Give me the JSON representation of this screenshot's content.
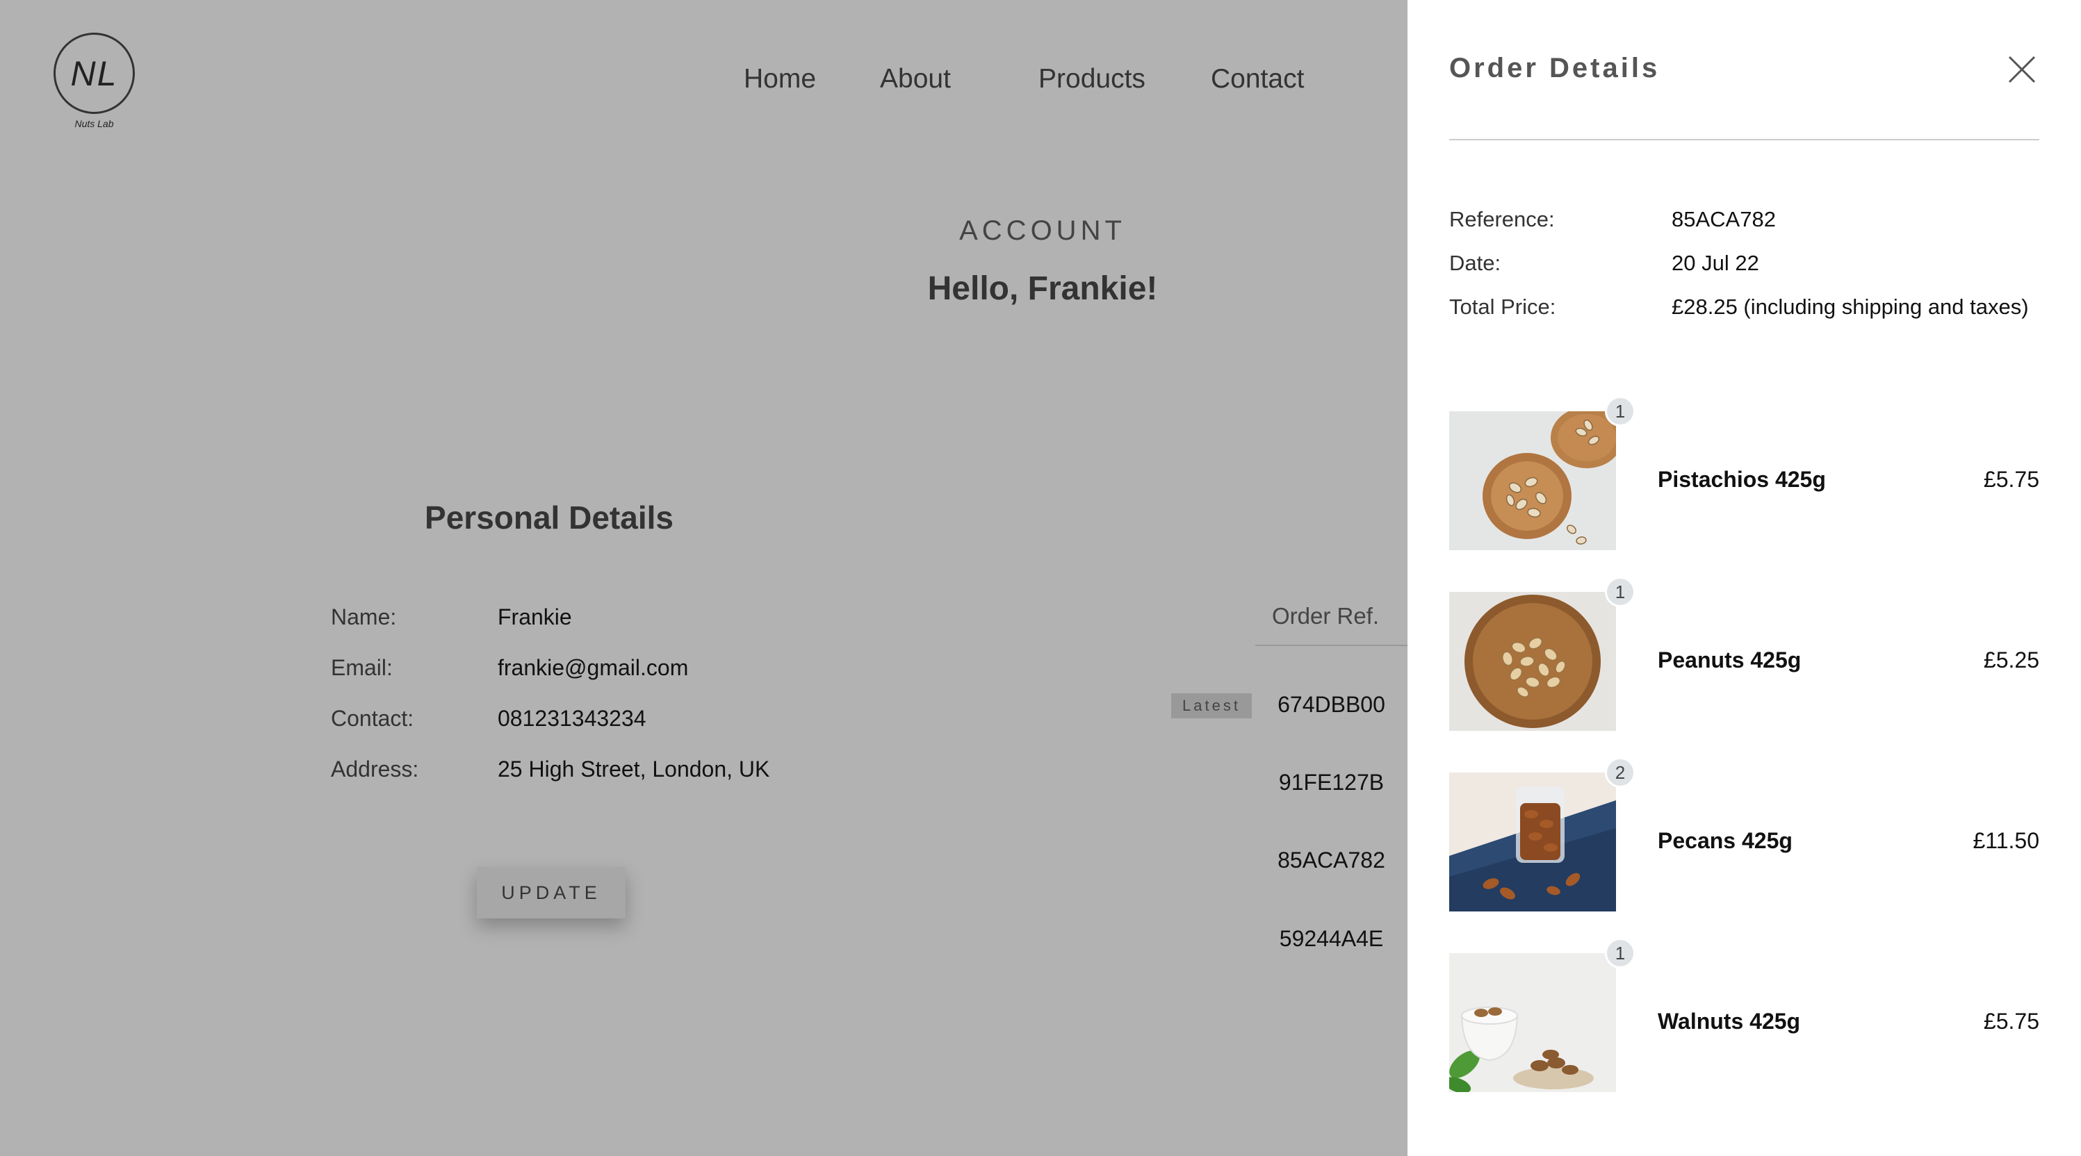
{
  "site": {
    "logo_mark": "NL",
    "logo_text": "Nuts Lab",
    "nav": [
      "Home",
      "About",
      "Products",
      "Contact"
    ]
  },
  "account": {
    "kicker": "ACCOUNT",
    "greeting": "Hello, Frankie!"
  },
  "personal_details": {
    "title": "Personal Details",
    "rows": [
      {
        "label": "Name:",
        "value": "Frankie"
      },
      {
        "label": "Email:",
        "value": "frankie@gmail.com"
      },
      {
        "label": "Contact:",
        "value": "081231343234"
      },
      {
        "label": "Address:",
        "value": "25 High Street, London, UK"
      }
    ],
    "update_label": "UPDATE"
  },
  "orders": {
    "header": "Order Ref.",
    "latest_badge": "Latest",
    "refs": [
      "674DBB00",
      "91FE127B",
      "85ACA782",
      "59244A4E"
    ]
  },
  "drawer": {
    "title": "Order Details",
    "meta": [
      {
        "label": "Reference:",
        "value": "85ACA782"
      },
      {
        "label": "Date:",
        "value": "20 Jul 22"
      },
      {
        "label": "Total Price:",
        "value": "£28.25 (including shipping and taxes)"
      }
    ],
    "items": [
      {
        "name": "Pistachios 425g",
        "price": "£5.75",
        "qty": "1",
        "image": "pistachios-photo"
      },
      {
        "name": "Peanuts 425g",
        "price": "£5.25",
        "qty": "1",
        "image": "peanuts-photo"
      },
      {
        "name": "Pecans 425g",
        "price": "£11.50",
        "qty": "2",
        "image": "pecans-photo"
      },
      {
        "name": "Walnuts 425g",
        "price": "£5.75",
        "qty": "1",
        "image": "walnuts-photo"
      }
    ]
  },
  "colors": {
    "overlay_bg": "#b2b2b2",
    "drawer_bg": "#ffffff",
    "badge_bg": "#dfe3e6"
  }
}
